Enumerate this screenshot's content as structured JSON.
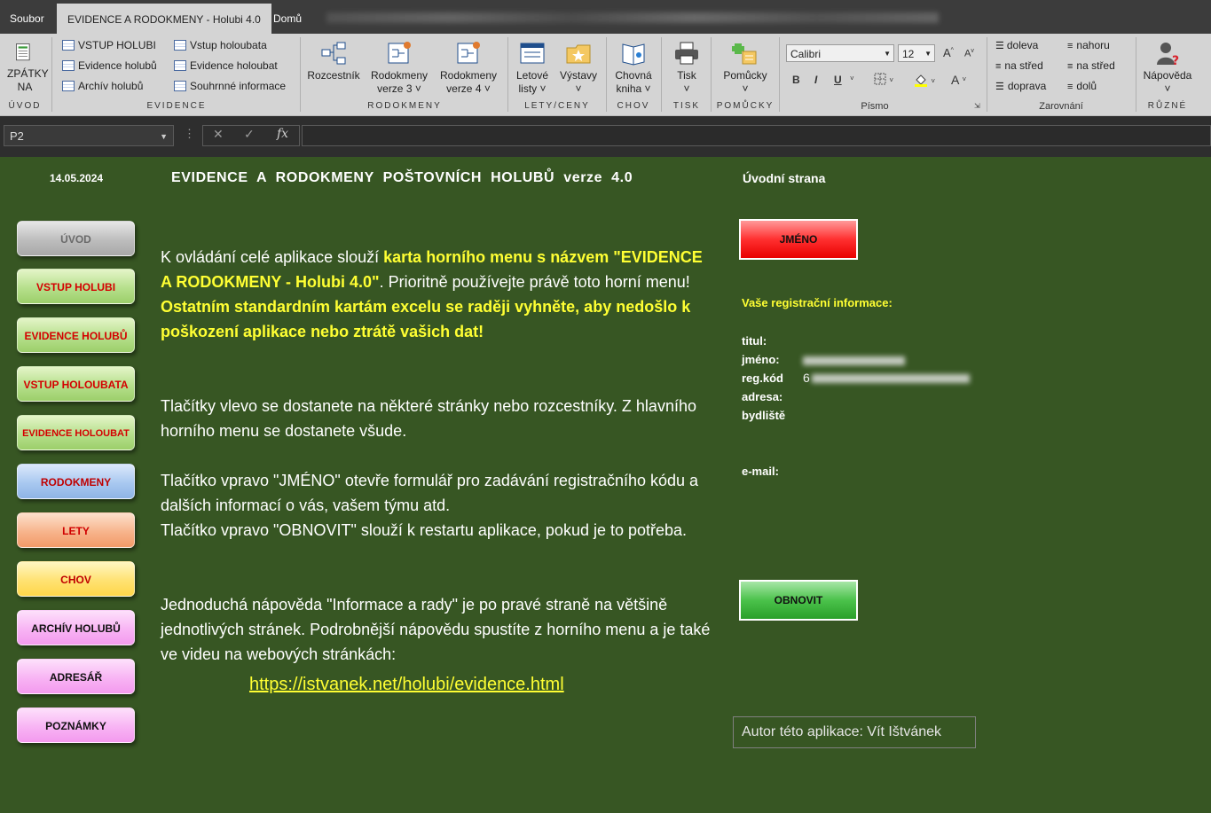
{
  "tabs": [
    "Soubor",
    "EVIDENCE A RODOKMENY - Holubi 4.0",
    "Domů"
  ],
  "ribbon": {
    "uvod": {
      "back_label": "ZPÁTKY NA",
      "group": "ÚVOD"
    },
    "evidence": {
      "items_left": [
        "VSTUP HOLUBI",
        "Evidence holubů",
        "Archív holubů"
      ],
      "items_right": [
        "Vstup holoubata",
        "Evidence holoubat",
        "Souhrnné informace"
      ],
      "group": "EVIDENCE"
    },
    "rodokmeny": {
      "buttons": [
        {
          "line1": "Rozcestník",
          "line2": ""
        },
        {
          "line1": "Rodokmeny",
          "line2": "verze 3 ˅"
        },
        {
          "line1": "Rodokmeny",
          "line2": "verze 4 ˅"
        }
      ],
      "group": "RODOKMENY"
    },
    "lety": {
      "buttons": [
        {
          "line1": "Letové",
          "line2": "listy ˅"
        },
        {
          "line1": "Výstavy",
          "line2": "˅"
        }
      ],
      "group": "LETY/CENY"
    },
    "chov": {
      "line1": "Chovná",
      "line2": "kniha ˅",
      "group": "CHOV"
    },
    "tisk": {
      "line1": "Tisk",
      "line2": "˅",
      "group": "TISK"
    },
    "pomucky": {
      "line1": "Pomůcky",
      "line2": "˅",
      "group": "POMŮCKY"
    },
    "pismo": {
      "font": "Calibri",
      "size": "12",
      "grow": "A",
      "shrink": "A",
      "bold": "B",
      "italic": "I",
      "underline": "U",
      "fontcolor": "A",
      "group": "Písmo"
    },
    "zarovnani": {
      "items": [
        "doleva",
        "na střed",
        "doprava",
        "nahoru",
        "na střed",
        "dolů"
      ],
      "group": "Zarovnání"
    },
    "ruzne": {
      "line1": "Nápověda",
      "line2": "˅",
      "group": "RŮZNÉ"
    }
  },
  "formula_bar": {
    "name_box": "P2",
    "cancel": "✕",
    "enter": "✓",
    "fx": "fx",
    "value": ""
  },
  "sheet": {
    "date": "14.05.2024",
    "title": "EVIDENCE A RODOKMENY POŠTOVNÍCH HOLUBŮ   verze 4.0",
    "page_label": "Úvodní strana",
    "nav_buttons": [
      {
        "label": "ÚVOD",
        "style": "gray"
      },
      {
        "label": "VSTUP HOLUBI",
        "style": "green"
      },
      {
        "label": "EVIDENCE HOLUBŮ",
        "style": "green"
      },
      {
        "label": "VSTUP HOLOUBATA",
        "style": "green"
      },
      {
        "label": "EVIDENCE HOLOUBAT",
        "style": "green"
      },
      {
        "label": "RODOKMENY",
        "style": "blue"
      },
      {
        "label": "LETY",
        "style": "orange"
      },
      {
        "label": "CHOV",
        "style": "yellow"
      },
      {
        "label": "ARCHÍV HOLUBŮ",
        "style": "pink"
      },
      {
        "label": "ADRESÁŘ",
        "style": "pink"
      },
      {
        "label": "POZNÁMKY",
        "style": "pink"
      }
    ],
    "para1_a": "K ovládání celé aplikace slouží ",
    "para1_b": "karta horního menu s názvem \"EVIDENCE A RODOKMENY - Holubi 4.0\"",
    "para1_c": ". Prioritně používejte právě toto horní menu!",
    "para1_d": "Ostatním standardním kartám excelu se raději vyhněte, aby nedošlo k poškození aplikace nebo ztrátě vašich dat!",
    "para2": "Tlačítky vlevo se dostanete na některé stránky nebo rozcestníky. Z hlavního horního menu se dostanete všude.",
    "para3_a": "Tlačítko vpravo \"JMÉNO\" otevře formulář pro zadávání registračního kódu a dalších informací o vás, vašem týmu atd.",
    "para3_b": "Tlačítko vpravo \"OBNOVIT\" slouží k restartu aplikace, pokud je to potřeba.",
    "para4": "Jednoduchá nápověda \"Informace a rady\" je po pravé straně na většině jednotlivých stránek. Podrobnější nápovědu spustíte z horního menu a je také ve videu na webových stránkách:",
    "link": " https://istvanek.net/holubi/evidence.html",
    "btn_jmeno": "JMÉNO",
    "btn_obnovit": "OBNOVIT",
    "reg_heading": "Vaše registrační informace:",
    "reg_labels": [
      "titul:",
      "jméno:",
      "reg.kód",
      "adresa:",
      "bydliště"
    ],
    "reg_code_prefix": "6",
    "email_label": "e-mail:",
    "author": "Autor této aplikace: Vít Ištvánek"
  }
}
